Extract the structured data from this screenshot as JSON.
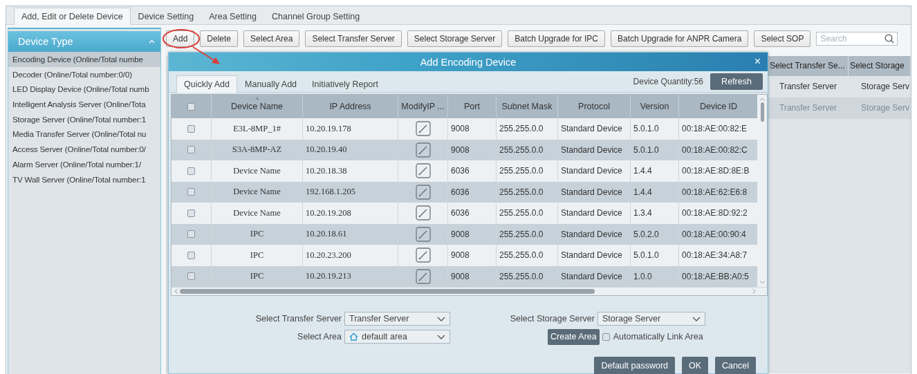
{
  "main_tabs": [
    {
      "label": "Add, Edit or Delete Device",
      "selected": true
    },
    {
      "label": "Device Setting",
      "selected": false
    },
    {
      "label": "Area Setting",
      "selected": false
    },
    {
      "label": "Channel Group Setting",
      "selected": false
    }
  ],
  "sidebar": {
    "title": "Device Type",
    "expanded": true,
    "items": [
      {
        "label": "Encoding Device (Online/Total numbe",
        "selected": true
      },
      {
        "label": "Decoder (Online/Total number:0/0)",
        "selected": false
      },
      {
        "label": "LED Display Device (Online/Total numb",
        "selected": false
      },
      {
        "label": "Intelligent Analysis Server (Online/Tota",
        "selected": false
      },
      {
        "label": "Storage Server (Online/Total number:1",
        "selected": false
      },
      {
        "label": "Media Transfer Server (Online/Total nu",
        "selected": false
      },
      {
        "label": "Access Server (Online/Total number:0/",
        "selected": false
      },
      {
        "label": "Alarm Server (Online/Total number:1/",
        "selected": false
      },
      {
        "label": "TV Wall Server (Online/Total number:1",
        "selected": false
      }
    ]
  },
  "toolbar": {
    "buttons": [
      "Add",
      "Delete",
      "Select Area",
      "Select Transfer Server",
      "Select Storage Server",
      "Batch Upgrade for IPC",
      "Batch Upgrade for ANPR Camera",
      "Select SOP"
    ],
    "search": {
      "placeholder": "Search"
    }
  },
  "device_table": {
    "columns": [
      "Select Transfer Se...",
      "Select Storage"
    ],
    "rows": [
      {
        "cells": [
          "Transfer Server",
          "Storage Serv"
        ],
        "disabled": false
      },
      {
        "cells": [
          "Transfer Server",
          "Storage Serv"
        ],
        "disabled": true
      }
    ]
  },
  "dialog": {
    "title": "Add Encoding Device",
    "close": "×",
    "tabs": [
      {
        "label": "Quickly Add",
        "selected": true
      },
      {
        "label": "Manually Add",
        "selected": false
      },
      {
        "label": "Initiatively Report",
        "selected": false
      }
    ],
    "device_quantity": "Device Quantity:56",
    "refresh": "Refresh",
    "table": {
      "all_checked": false,
      "columns": [
        "Device Name",
        "IP Address",
        "ModifyIP ...",
        "Port",
        "Subnet Mask",
        "Protocol",
        "Version",
        "Device ID"
      ],
      "rows": [
        {
          "checked": false,
          "name": "E3L-8MP_1#",
          "ip": "10.20.19.178",
          "port": "9008",
          "mask": "255.255.0.0",
          "protocol": "Standard Device",
          "version": "5.0.1.0",
          "id": "00:18:AE:00:82:E"
        },
        {
          "checked": false,
          "name": "S3A-8MP-AZ",
          "ip": "10.20.19.40",
          "port": "9008",
          "mask": "255.255.0.0",
          "protocol": "Standard Device",
          "version": "5.0.1.0",
          "id": "00:18:AE:00:82:C"
        },
        {
          "checked": false,
          "name": "Device Name",
          "ip": "10.20.18.38",
          "port": "6036",
          "mask": "255.255.0.0",
          "protocol": "Standard Device",
          "version": "1.4.4",
          "id": "00:18:AE:8D:8E:B"
        },
        {
          "checked": false,
          "name": "Device Name",
          "ip": "192.168.1.205",
          "port": "6036",
          "mask": "255.255.0.0",
          "protocol": "Standard Device",
          "version": "1.4.4",
          "id": "00:18:AE:62:E6:8"
        },
        {
          "checked": false,
          "name": "Device Name",
          "ip": "10.20.19.208",
          "port": "6036",
          "mask": "255.255.0.0",
          "protocol": "Standard Device",
          "version": "1.3.4",
          "id": "00:18:AE:8D:92:2"
        },
        {
          "checked": false,
          "name": "IPC",
          "ip": "10.20.18.61",
          "port": "9008",
          "mask": "255.255.0.0",
          "protocol": "Standard Device",
          "version": "5.0.2.0",
          "id": "00:18:AE:00:90:4"
        },
        {
          "checked": false,
          "name": "IPC",
          "ip": "10.20.23.200",
          "port": "9008",
          "mask": "255.255.0.0",
          "protocol": "Standard Device",
          "version": "5.0.1.0",
          "id": "00:18:AE:34:A8:7"
        },
        {
          "checked": false,
          "name": "IPC",
          "ip": "10.20.19.213",
          "port": "9008",
          "mask": "255.255.0.0",
          "protocol": "Standard Device",
          "version": "1.0.0",
          "id": "00:18:AE:BB:A0:5"
        }
      ]
    },
    "form": {
      "transfer_label": "Select Transfer Server",
      "transfer_value": "Transfer Server",
      "storage_label": "Select Storage Server",
      "storage_value": "Storage Server",
      "area_label": "Select Area",
      "area_value": "default area",
      "create_area": "Create Area",
      "auto_link": {
        "label": "Automatically Link Area",
        "checked": false
      }
    },
    "buttons": [
      "Default password",
      "OK",
      "Cancel"
    ]
  }
}
